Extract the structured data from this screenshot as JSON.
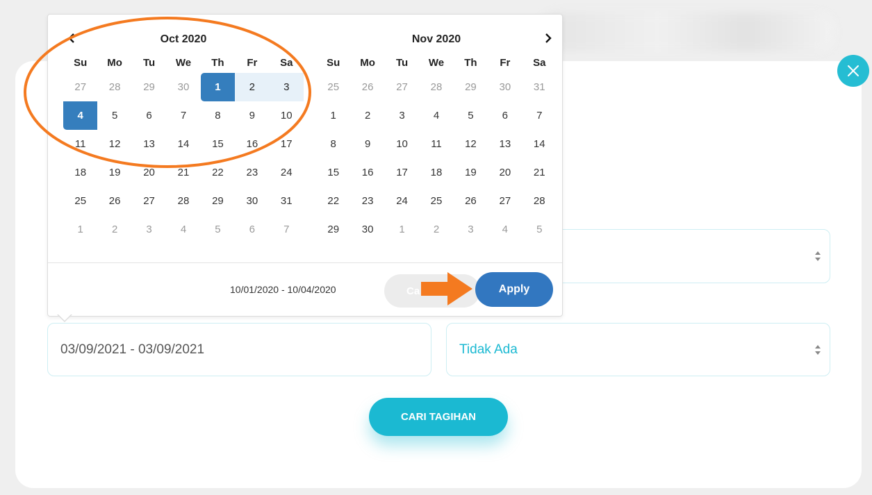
{
  "colors": {
    "accent": "#1bb9d2",
    "selected": "#357ebd",
    "range": "#e7f1f9",
    "annotation": "#f47a20",
    "apply": "#3277c0"
  },
  "date_picker": {
    "left_month": {
      "title": "Oct 2020",
      "weekdays": [
        "Su",
        "Mo",
        "Tu",
        "We",
        "Th",
        "Fr",
        "Sa"
      ],
      "days": [
        [
          "27",
          "28",
          "29",
          "30",
          "1",
          "2",
          "3"
        ],
        [
          "4",
          "5",
          "6",
          "7",
          "8",
          "9",
          "10"
        ],
        [
          "11",
          "12",
          "13",
          "14",
          "15",
          "16",
          "17"
        ],
        [
          "18",
          "19",
          "20",
          "21",
          "22",
          "23",
          "24"
        ],
        [
          "25",
          "26",
          "27",
          "28",
          "29",
          "30",
          "31"
        ],
        [
          "1",
          "2",
          "3",
          "4",
          "5",
          "6",
          "7"
        ]
      ]
    },
    "right_month": {
      "title": "Nov 2020",
      "weekdays": [
        "Su",
        "Mo",
        "Tu",
        "We",
        "Th",
        "Fr",
        "Sa"
      ],
      "days": [
        [
          "25",
          "26",
          "27",
          "28",
          "29",
          "30",
          "31"
        ],
        [
          "1",
          "2",
          "3",
          "4",
          "5",
          "6",
          "7"
        ],
        [
          "8",
          "9",
          "10",
          "11",
          "12",
          "13",
          "14"
        ],
        [
          "15",
          "16",
          "17",
          "18",
          "19",
          "20",
          "21"
        ],
        [
          "22",
          "23",
          "24",
          "25",
          "26",
          "27",
          "28"
        ],
        [
          "29",
          "30",
          "1",
          "2",
          "3",
          "4",
          "5"
        ]
      ]
    },
    "prev_icon": "chevron-left-icon",
    "next_icon": "chevron-right-icon",
    "selected_range": "10/01/2020 - 10/04/2020",
    "cancel_label": "Ca",
    "apply_label": "Apply"
  },
  "form": {
    "date_range_value": "03/09/2021 - 03/09/2021",
    "select_value": "Tidak Ada",
    "search_button": "CARI TAGIHAN"
  },
  "close_icon": "close-icon",
  "annotations": {
    "circle": "orange-ellipse-highlight",
    "arrow": "orange-arrow-pointer"
  }
}
